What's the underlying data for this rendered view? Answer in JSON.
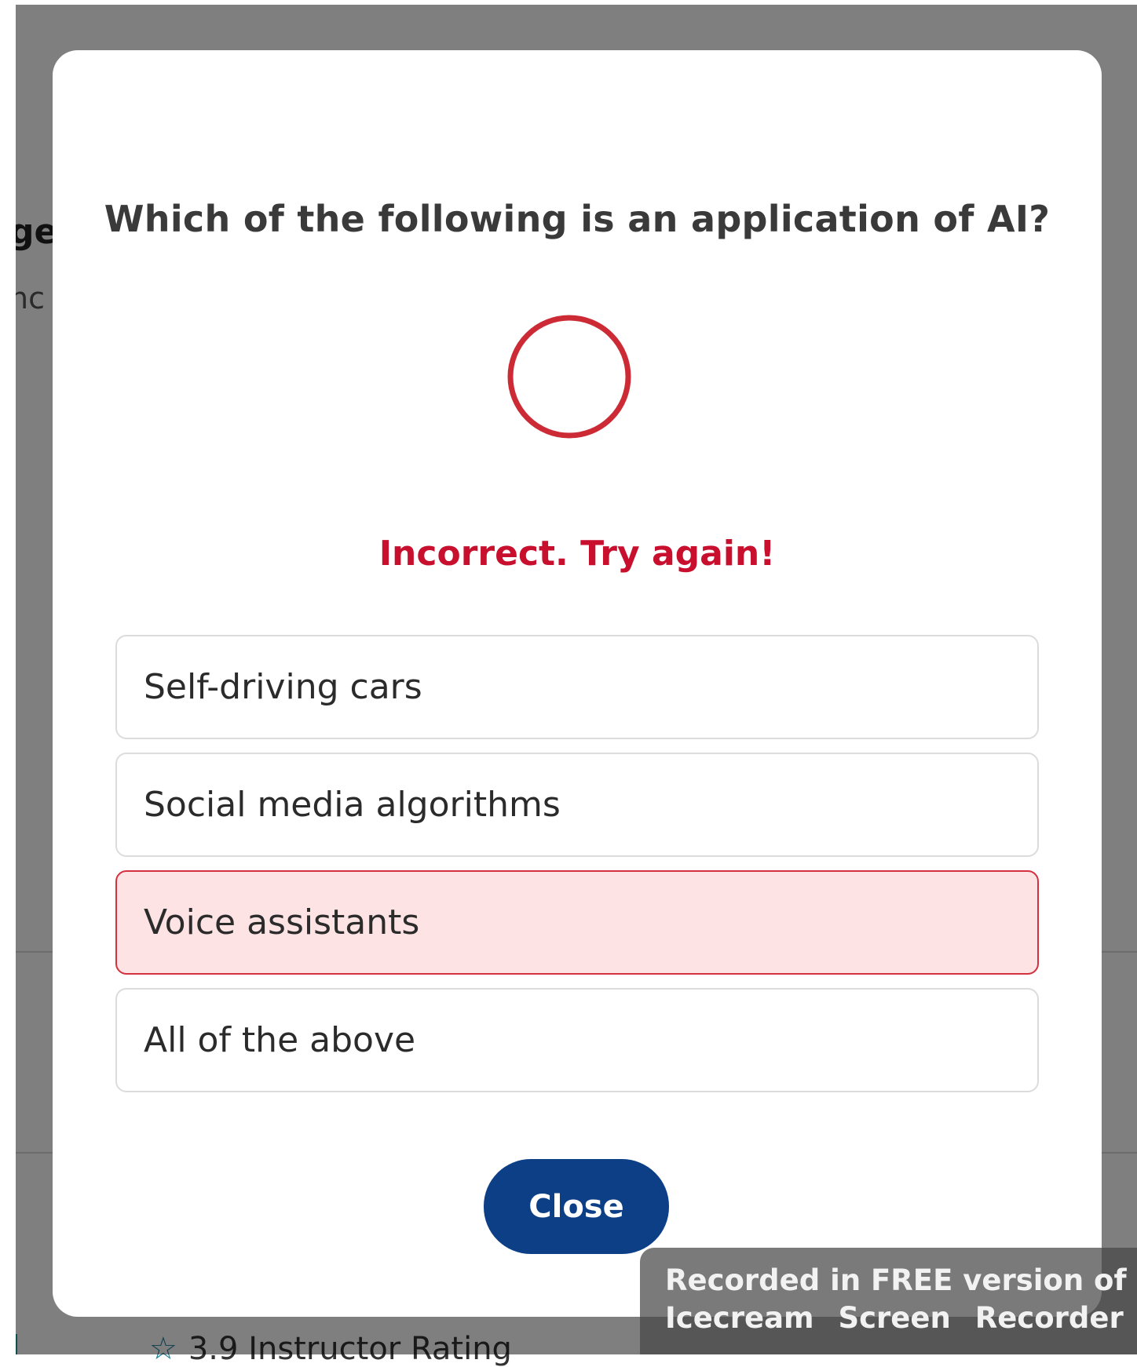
{
  "background": {
    "fragment_1": "ge",
    "fragment_2": "nc",
    "rating_text": "3.9 Instructor Rating"
  },
  "quiz": {
    "question": "Which of the following is an application of AI?",
    "result_icon": "circle-outline-icon",
    "feedback": "Incorrect. Try again!",
    "options": [
      {
        "label": "Self-driving cars",
        "state": "default"
      },
      {
        "label": "Social media algorithms",
        "state": "default"
      },
      {
        "label": "Voice assistants",
        "state": "incorrect"
      },
      {
        "label": "All of the above",
        "state": "default"
      }
    ],
    "close_label": "Close"
  },
  "watermark": {
    "line1": "Recorded in FREE version of",
    "line2": "Icecream Screen Recorder"
  },
  "colors": {
    "error": "#c8102e",
    "wrong_option_bg": "#fde3e4",
    "wrong_option_border": "#d3313f",
    "primary_button": "#0d3f87",
    "ring": "#cc2a35"
  }
}
